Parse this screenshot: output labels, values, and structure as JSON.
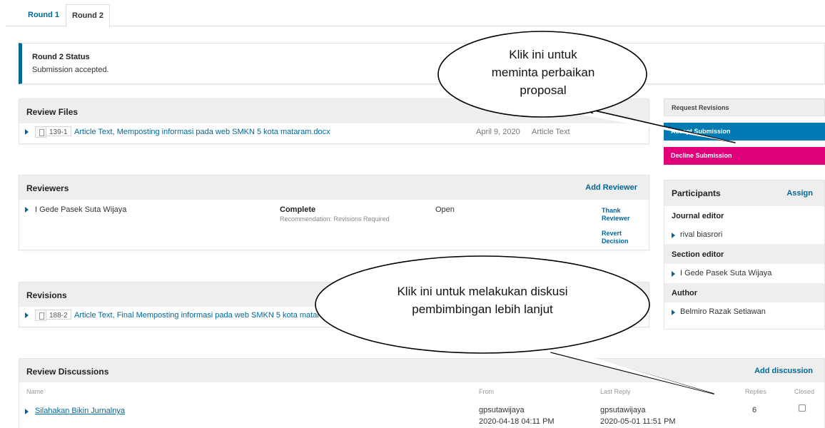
{
  "tabs": [
    {
      "label": "Round 1"
    },
    {
      "label": "Round 2"
    }
  ],
  "status": {
    "title": "Round 2 Status",
    "text": "Submission accepted."
  },
  "review_files": {
    "title": "Review Files",
    "file": {
      "id": "139-1",
      "name": "Article Text, Memposting informasi pada web SMKN 5 kota mataram.docx",
      "date": "April 9, 2020",
      "type": "Article Text"
    }
  },
  "actions": {
    "request_revisions": "Request Revisions",
    "accept_submission": "Accept Submission",
    "decline_submission": "Decline Submission"
  },
  "reviewers": {
    "title": "Reviewers",
    "add_label": "Add Reviewer",
    "rows": [
      {
        "name": "I Gede Pasek Suta Wijaya",
        "status": "Complete",
        "recommendation": "Recommendation: Revisions Required",
        "state": "Open",
        "action1_line1": "Thank",
        "action1_line2": "Reviewer",
        "action2_line1": "Revert",
        "action2_line2": "Decision"
      }
    ]
  },
  "participants": {
    "title": "Participants",
    "assign_label": "Assign",
    "groups": [
      {
        "role": "Journal editor",
        "member": "rival biasrori"
      },
      {
        "role": "Section editor",
        "member": "I Gede Pasek Suta Wijaya"
      },
      {
        "role": "Author",
        "member": "Belmiro Razak Setiawan"
      }
    ]
  },
  "revisions": {
    "title": "Revisions",
    "file": {
      "id": "188-2",
      "name": "Article Text, Final Memposting informasi pada web SMKN 5 kota mataram"
    }
  },
  "discussions": {
    "title": "Review Discussions",
    "add_label": "Add discussion",
    "columns": {
      "name": "Name",
      "from": "From",
      "last_reply": "Last Reply",
      "replies": "Replies",
      "closed": "Closed"
    },
    "rows": [
      {
        "name": "Silahakan Bikin Jurnalnya",
        "from_user": "gpsutawijaya",
        "from_date": "2020-04-18 04:11 PM",
        "reply_user": "gpsutawijaya",
        "reply_date": "2020-05-01 11:51 PM",
        "replies": "6"
      }
    ]
  },
  "callouts": {
    "top_line1": "Klik ini untuk",
    "top_line2": "meminta perbaikan",
    "top_line3": "proposal",
    "bottom_line1": "Klik ini untuk melakukan diskusi",
    "bottom_line2": "pembimbingan lebih lanjut"
  },
  "colors": {
    "link": "#006798",
    "accept": "#007ab2",
    "decline": "#e0007a"
  }
}
